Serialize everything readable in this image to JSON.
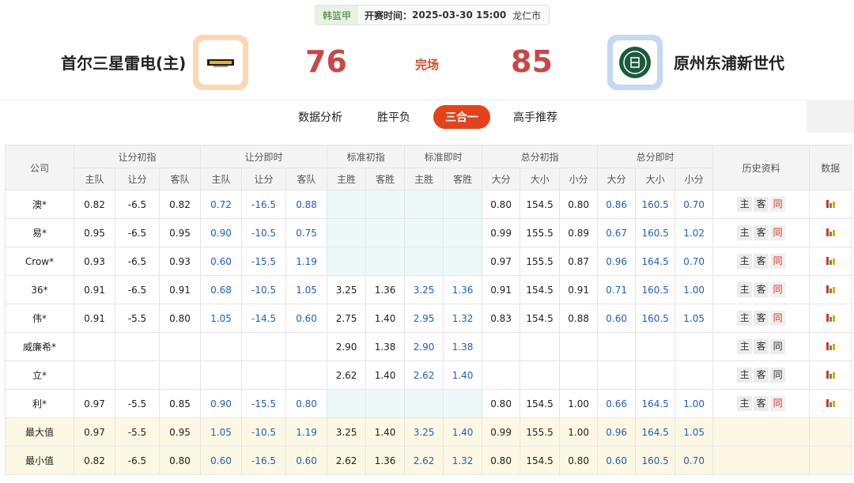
{
  "match": {
    "league": "韩篮甲",
    "time_label": "开赛时间：",
    "time": "2025-03-30 15:00",
    "city": "龙仁市",
    "home": "首尔三星雷电(主)",
    "away": "原州东浦新世代",
    "home_score": "76",
    "away_score": "85",
    "status": "完场"
  },
  "tabs": [
    "数据分析",
    "胜平负",
    "三合一",
    "高手推荐"
  ],
  "active_tab": "三合一",
  "table": {
    "col_company": "公司",
    "groups": [
      "让分初指",
      "让分即时",
      "标准初指",
      "标准即时",
      "总分初指",
      "总分即时"
    ],
    "history": "历史资料",
    "data": "数据",
    "sub_handicap": [
      "主队",
      "让分",
      "客队"
    ],
    "sub_standard": [
      "主胜",
      "客胜"
    ],
    "sub_total": [
      "大分",
      "大小",
      "小分"
    ],
    "history_btns": [
      "主",
      "客",
      "同"
    ],
    "rows": [
      {
        "company": "澳*",
        "hi": [
          "0.82",
          "-6.5",
          "0.82"
        ],
        "hn": [
          "0.72",
          "-16.5",
          "0.88"
        ],
        "si": [
          "",
          ""
        ],
        "sn": [
          "",
          ""
        ],
        "ti": [
          "0.80",
          "154.5",
          "0.80"
        ],
        "tn": [
          "0.86",
          "160.5",
          "0.70"
        ]
      },
      {
        "company": "易*",
        "hi": [
          "0.95",
          "-6.5",
          "0.95"
        ],
        "hn": [
          "0.90",
          "-10.5",
          "0.75"
        ],
        "si": [
          "",
          ""
        ],
        "sn": [
          "",
          ""
        ],
        "ti": [
          "0.99",
          "155.5",
          "0.89"
        ],
        "tn": [
          "0.67",
          "160.5",
          "1.02"
        ]
      },
      {
        "company": "Crow*",
        "hi": [
          "0.93",
          "-6.5",
          "0.93"
        ],
        "hn": [
          "0.60",
          "-15.5",
          "1.19"
        ],
        "si": [
          "",
          ""
        ],
        "sn": [
          "",
          ""
        ],
        "ti": [
          "0.97",
          "155.5",
          "0.87"
        ],
        "tn": [
          "0.96",
          "164.5",
          "0.70"
        ]
      },
      {
        "company": "36*",
        "hi": [
          "0.91",
          "-6.5",
          "0.91"
        ],
        "hn": [
          "0.68",
          "-10.5",
          "1.05"
        ],
        "si": [
          "3.25",
          "1.36"
        ],
        "sn": [
          "3.25",
          "1.36"
        ],
        "ti": [
          "0.91",
          "154.5",
          "0.91"
        ],
        "tn": [
          "0.71",
          "160.5",
          "1.00"
        ]
      },
      {
        "company": "伟*",
        "hi": [
          "0.91",
          "-5.5",
          "0.80"
        ],
        "hn": [
          "1.05",
          "-14.5",
          "0.60"
        ],
        "si": [
          "2.75",
          "1.40"
        ],
        "sn": [
          "2.95",
          "1.32"
        ],
        "ti": [
          "0.83",
          "154.5",
          "0.88"
        ],
        "tn": [
          "0.60",
          "160.5",
          "1.05"
        ]
      },
      {
        "company": "威廉希*",
        "hi": [
          "",
          "",
          ""
        ],
        "hn": [
          "",
          "",
          ""
        ],
        "si": [
          "2.90",
          "1.38"
        ],
        "sn": [
          "2.90",
          "1.38"
        ],
        "ti": [
          "",
          "",
          ""
        ],
        "tn": [
          "",
          "",
          ""
        ]
      },
      {
        "company": "立*",
        "hi": [
          "",
          "",
          ""
        ],
        "hn": [
          "",
          "",
          ""
        ],
        "si": [
          "2.62",
          "1.40"
        ],
        "sn": [
          "2.62",
          "1.40"
        ],
        "ti": [
          "",
          "",
          ""
        ],
        "tn": [
          "",
          "",
          ""
        ]
      },
      {
        "company": "利*",
        "hi": [
          "0.97",
          "-5.5",
          "0.85"
        ],
        "hn": [
          "0.90",
          "-15.5",
          "0.80"
        ],
        "si": [
          "",
          ""
        ],
        "sn": [
          "",
          ""
        ],
        "ti": [
          "0.80",
          "154.5",
          "1.00"
        ],
        "tn": [
          "0.66",
          "164.5",
          "1.00"
        ]
      }
    ],
    "red_same": [
      true,
      true,
      true,
      true,
      true,
      false,
      false,
      true
    ],
    "summary": [
      {
        "label": "最大值",
        "hi": [
          "0.97",
          "-5.5",
          "0.95"
        ],
        "hn": [
          "1.05",
          "-10.5",
          "1.19"
        ],
        "si": [
          "3.25",
          "1.40"
        ],
        "sn": [
          "3.25",
          "1.40"
        ],
        "ti": [
          "0.99",
          "155.5",
          "1.00"
        ],
        "tn": [
          "0.96",
          "164.5",
          "1.05"
        ]
      },
      {
        "label": "最小值",
        "hi": [
          "0.82",
          "-6.5",
          "0.80"
        ],
        "hn": [
          "0.60",
          "-16.5",
          "0.60"
        ],
        "si": [
          "2.62",
          "1.36"
        ],
        "sn": [
          "2.62",
          "1.32"
        ],
        "ti": [
          "0.80",
          "154.5",
          "0.80"
        ],
        "tn": [
          "0.60",
          "160.5",
          "0.70"
        ]
      }
    ]
  },
  "colors": {
    "accent": "#e5421c",
    "score": "#c84848",
    "link_blue": "#1f5fbf"
  }
}
